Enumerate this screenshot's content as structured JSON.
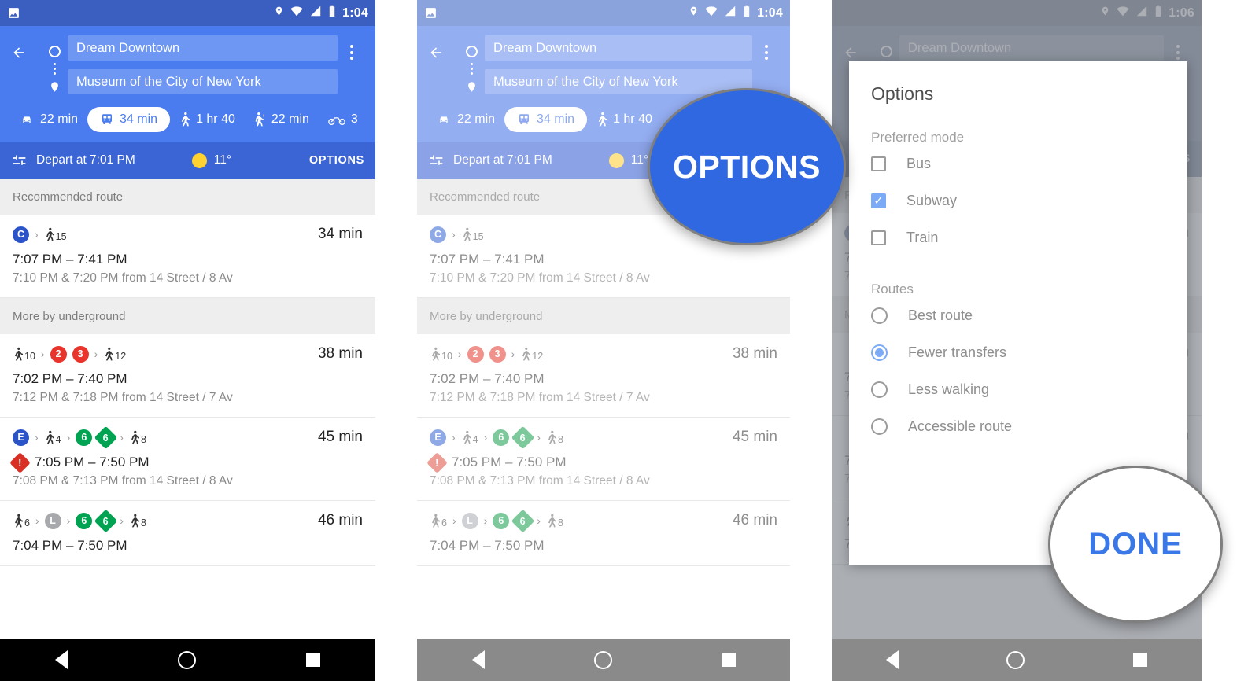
{
  "panes": [
    {
      "status": {
        "time": "1:04",
        "icons": [
          "gallery-icon",
          "location-icon",
          "wifi-icon",
          "signal-icon",
          "battery-icon"
        ]
      },
      "nav_icons": [
        "back-triangle-icon",
        "home-circle-icon",
        "recents-square-icon"
      ]
    },
    {
      "status": {
        "time": "1:04"
      }
    },
    {
      "status": {
        "time": "1:06"
      }
    }
  ],
  "header": {
    "back_icon": "arrow-back-icon",
    "origin_value": "Dream Downtown",
    "destination_value": "Museum of the City of New York",
    "origin_icon": "circle-outline-icon",
    "destination_icon": "map-pin-icon",
    "kebab_icon": "more-vert-icon",
    "modes": [
      {
        "icon": "car-icon",
        "label": "22 min",
        "selected": false
      },
      {
        "icon": "transit-icon",
        "label": "34 min",
        "selected": true
      },
      {
        "icon": "walk-icon",
        "label": "1 hr 40",
        "selected": false
      },
      {
        "icon": "rideshare-icon",
        "label": "22 min",
        "selected": false
      },
      {
        "icon": "bike-icon",
        "label": "3",
        "selected": false
      }
    ]
  },
  "departbar": {
    "tune_icon": "tune-icon",
    "depart_text": "Depart at 7:01 PM",
    "weather_icon": "sun-icon",
    "temperature": "11°",
    "options_label": "OPTIONS"
  },
  "sections": [
    {
      "title": "Recommended route",
      "routes": [
        {
          "legs": [
            {
              "type": "badge",
              "label": "C",
              "color": "#2a54c8",
              "shape": "circle"
            },
            {
              "type": "chev"
            },
            {
              "type": "walk",
              "minutes": "15"
            }
          ],
          "duration": "34 min",
          "times": "7:07 PM – 7:41 PM",
          "subtimes": "7:10 PM & 7:20 PM from 14 Street / 8 Av",
          "alert": false
        }
      ]
    },
    {
      "title": "More by underground",
      "routes": [
        {
          "legs": [
            {
              "type": "walk",
              "minutes": "10"
            },
            {
              "type": "chev"
            },
            {
              "type": "badge",
              "label": "2",
              "color": "#e8342a",
              "shape": "circle"
            },
            {
              "type": "badge",
              "label": "3",
              "color": "#e8342a",
              "shape": "circle"
            },
            {
              "type": "chev"
            },
            {
              "type": "walk",
              "minutes": "12"
            }
          ],
          "duration": "38 min",
          "times": "7:02 PM – 7:40 PM",
          "subtimes": "7:12 PM & 7:18 PM from 14 Street / 7 Av",
          "alert": false
        },
        {
          "legs": [
            {
              "type": "badge",
              "label": "E",
              "color": "#2a54c8",
              "shape": "circle"
            },
            {
              "type": "chev"
            },
            {
              "type": "walk",
              "minutes": "4"
            },
            {
              "type": "chev"
            },
            {
              "type": "badge",
              "label": "6",
              "color": "#00a352",
              "shape": "circle"
            },
            {
              "type": "badge",
              "label": "6",
              "color": "#00a352",
              "shape": "diamond"
            },
            {
              "type": "chev"
            },
            {
              "type": "walk",
              "minutes": "8"
            }
          ],
          "duration": "45 min",
          "times": "7:05 PM – 7:50 PM",
          "subtimes": "7:08 PM & 7:13 PM from 14 Street / 8 Av",
          "alert": true,
          "alert_icon": "alert-diamond-icon"
        },
        {
          "legs": [
            {
              "type": "walk",
              "minutes": "6"
            },
            {
              "type": "chev"
            },
            {
              "type": "badge",
              "label": "L",
              "color": "#a7a9ac",
              "shape": "circle"
            },
            {
              "type": "chev"
            },
            {
              "type": "badge",
              "label": "6",
              "color": "#00a352",
              "shape": "circle"
            },
            {
              "type": "badge",
              "label": "6",
              "color": "#00a352",
              "shape": "diamond"
            },
            {
              "type": "chev"
            },
            {
              "type": "walk",
              "minutes": "8"
            }
          ],
          "duration": "46 min",
          "times": "7:04 PM – 7:50 PM",
          "subtimes": "",
          "alert": false
        }
      ]
    }
  ],
  "dialog": {
    "title": "Options",
    "preferred_mode_label": "Preferred mode",
    "modes": [
      {
        "label": "Bus",
        "checked": false
      },
      {
        "label": "Subway",
        "checked": true
      },
      {
        "label": "Train",
        "checked": false
      }
    ],
    "routes_label": "Routes",
    "route_prefs": [
      {
        "label": "Best route",
        "selected": false
      },
      {
        "label": "Fewer transfers",
        "selected": true
      },
      {
        "label": "Less walking",
        "selected": false
      },
      {
        "label": "Accessible route",
        "selected": false
      }
    ]
  },
  "callouts": [
    {
      "name": "options-callout",
      "text": "OPTIONS",
      "bg": "#2f68e0",
      "fg": "#ffffff"
    },
    {
      "name": "done-callout",
      "text": "DONE",
      "bg": "#ffffff",
      "fg": "#3b78e7"
    }
  ]
}
